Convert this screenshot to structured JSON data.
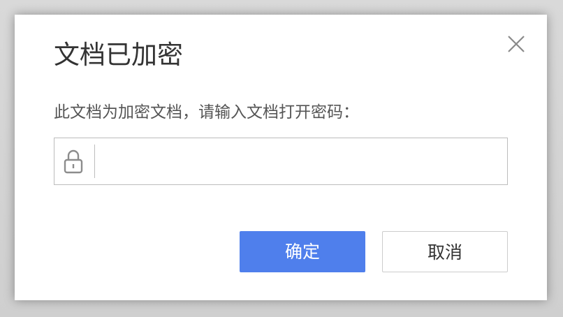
{
  "dialog": {
    "title": "文档已加密",
    "prompt": "此文档为加密文档，请输入文档打开密码：",
    "password": {
      "value": "",
      "placeholder": ""
    },
    "ok_label": "确定",
    "cancel_label": "取消"
  },
  "icons": {
    "close": "close-icon",
    "lock": "lock-icon"
  },
  "colors": {
    "primary_button": "#4f7fec",
    "title_text": "#333333",
    "prompt_text": "#555555",
    "border": "#bcbcbc"
  }
}
